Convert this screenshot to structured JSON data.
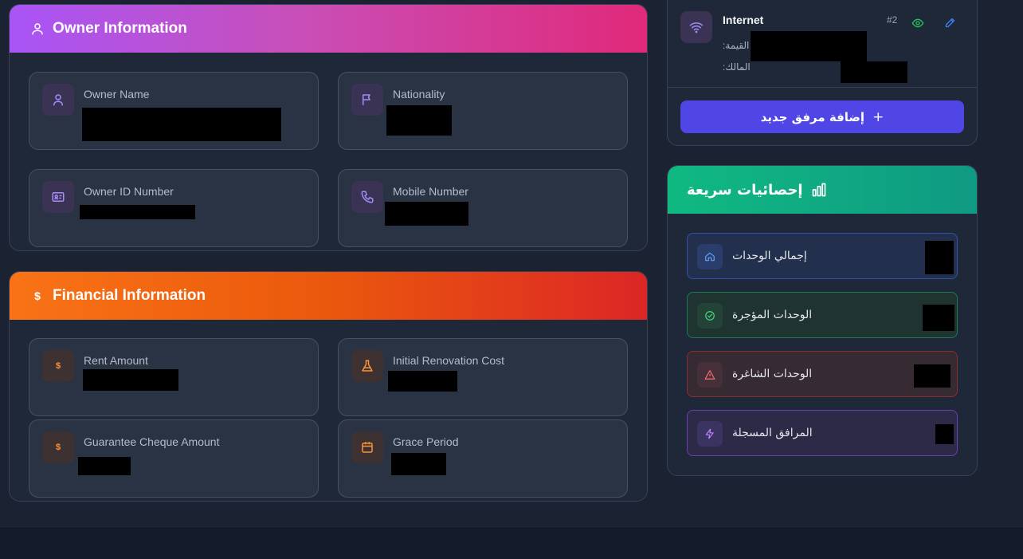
{
  "owner": {
    "title": "Owner Information",
    "fields": [
      {
        "label": "Owner Name"
      },
      {
        "label": "Nationality"
      },
      {
        "label": "Owner ID Number"
      },
      {
        "label": "Mobile Number"
      }
    ]
  },
  "financial": {
    "title": "Financial Information",
    "fields": [
      {
        "label": "Rent Amount"
      },
      {
        "label": "Initial Renovation Cost"
      },
      {
        "label": "Guarantee Cheque Amount"
      },
      {
        "label": "Grace Period"
      }
    ]
  },
  "facility": {
    "name": "Internet",
    "number": "#2",
    "value_label": "القيمة:",
    "owner_label": "المالك:",
    "add_button_label": "إضافة مرفق جديد",
    "add_button_icon": "+"
  },
  "stats": {
    "title": "إحصائيات سريعة",
    "items": [
      {
        "label": "إجمالي الوحدات",
        "icon": "home-icon",
        "color": "#3b82f6"
      },
      {
        "label": "الوحدات المؤجرة",
        "icon": "check-circle-icon",
        "color": "#22c55e"
      },
      {
        "label": "الوحدات الشاغرة",
        "icon": "warning-icon",
        "color": "#ef4444"
      },
      {
        "label": "المرافق المسجلة",
        "icon": "bolt-icon",
        "color": "#a855f7"
      }
    ]
  },
  "colors": {
    "owner_gradient": [
      "#a855f7",
      "#e0297a"
    ],
    "financial_gradient": [
      "#f97316",
      "#dc2626"
    ],
    "stats_gradient": [
      "#10b981",
      "#0f9a83"
    ],
    "button": "#4f46e5"
  }
}
